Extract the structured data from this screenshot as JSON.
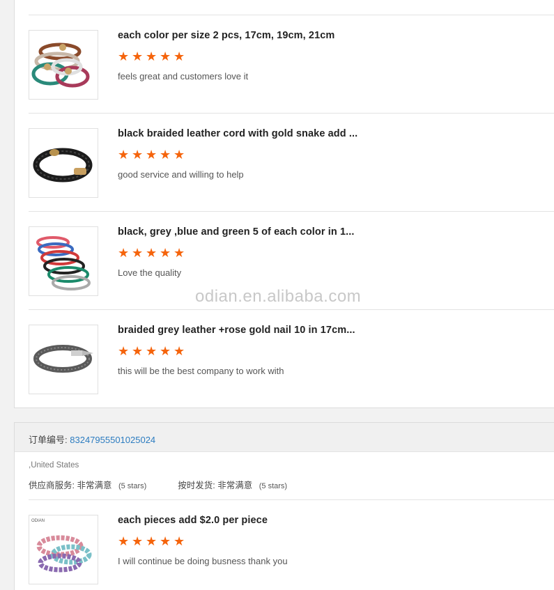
{
  "reviews_group1": [
    {
      "product_title": "each color per size 2 pcs, 17cm, 19cm, 21cm",
      "rating": 5,
      "comment": "feels great and customers love it",
      "image": "multicolor-bracelets-thumbnail"
    },
    {
      "product_title": "black braided leather cord with gold snake add ...",
      "rating": 5,
      "comment": "good service and willing to help",
      "image": "black-braided-bracelet-thumbnail"
    },
    {
      "product_title": "black, grey ,blue and green 5 of each color in 1...",
      "rating": 5,
      "comment": "Love the quality",
      "image": "stacked-bangles-thumbnail"
    },
    {
      "product_title": "braided grey leather +rose gold nail 10 in 17cm...",
      "rating": 5,
      "comment": "this will be the best company to work with",
      "image": "grey-nail-bracelet-thumbnail"
    }
  ],
  "watermark": "odian.en.alibaba.com",
  "order2": {
    "order_label": "订单编号:",
    "order_number": "83247955501025024",
    "country": ",United States",
    "supplier_service_label": "供应商服务:",
    "supplier_service_value": "非常满意",
    "supplier_service_stars": "(5 stars)",
    "delivery_label": "按时发货:",
    "delivery_value": "非常满意",
    "delivery_stars": "(5 stars)",
    "review": {
      "product_title": "each pieces add $2.0 per piece",
      "rating": 5,
      "comment": "I will continue be doing busness thank you",
      "image": "beaded-bracelets-thumbnail",
      "image_brand": "ODIAN"
    }
  },
  "colors": {
    "star": "#f5640c",
    "link": "#2c7cc0",
    "watermark": "#c8c8c8"
  },
  "icons": {
    "star": "star-icon"
  }
}
